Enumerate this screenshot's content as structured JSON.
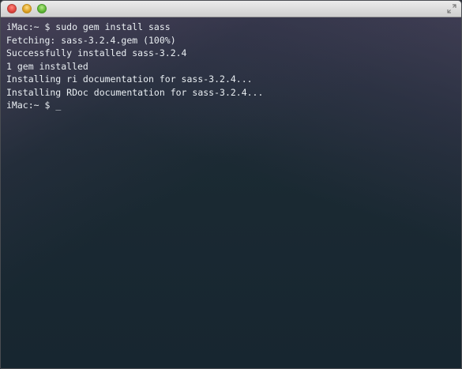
{
  "window": {
    "controls": [
      "close",
      "minimize",
      "zoom"
    ],
    "fullscreen_icon": "fullscreen-arrows-icon"
  },
  "terminal": {
    "lines": [
      "iMac:~ $ sudo gem install sass",
      "Fetching: sass-3.2.4.gem (100%)",
      "Successfully installed sass-3.2.4",
      "1 gem installed",
      "Installing ri documentation for sass-3.2.4...",
      "Installing RDoc documentation for sass-3.2.4..."
    ],
    "prompt": "iMac:~ $ ",
    "cursor": "_"
  }
}
